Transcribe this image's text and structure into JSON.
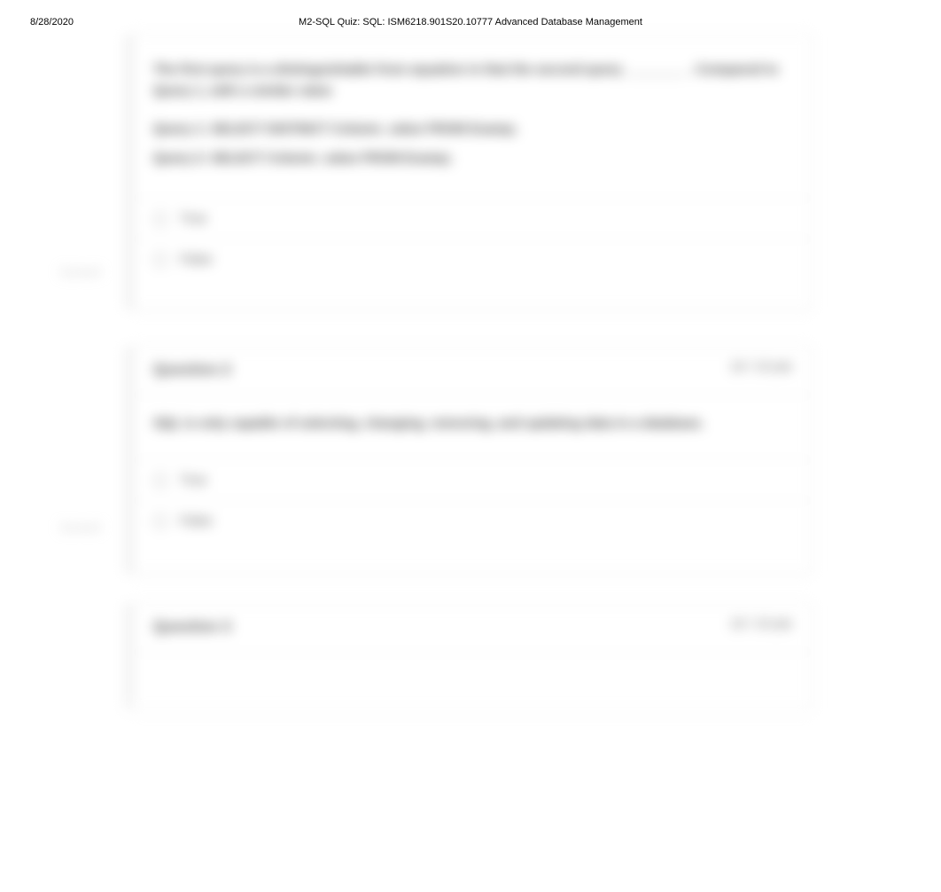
{
  "header": {
    "date": "8/28/2020",
    "title": "M2-SQL Quiz: SQL: ISM6218.901S20.10777 Advanced Database Management"
  },
  "markers": {
    "correct1": "Correct!",
    "correct2": "Correct!"
  },
  "q1_partial": {
    "text": "The first query is a distinguishable from equation in that the second query ________ . Compared to Query 1, with a similar value",
    "line1": "Query 1: SELECT DISTINCT Column_value FROM Examp;",
    "line2": "Query 2: SELECT Column_value FROM Examp;",
    "opt1": "True",
    "opt2": "False"
  },
  "q2": {
    "title": "Question 2",
    "pts": "10 / 10 pts",
    "text": "SQL is only capable of selecting, changing, removing, and updating data in a database.",
    "opt1": "True",
    "opt2": "False"
  },
  "q3": {
    "title": "Question 3",
    "pts": "10 / 10 pts"
  }
}
